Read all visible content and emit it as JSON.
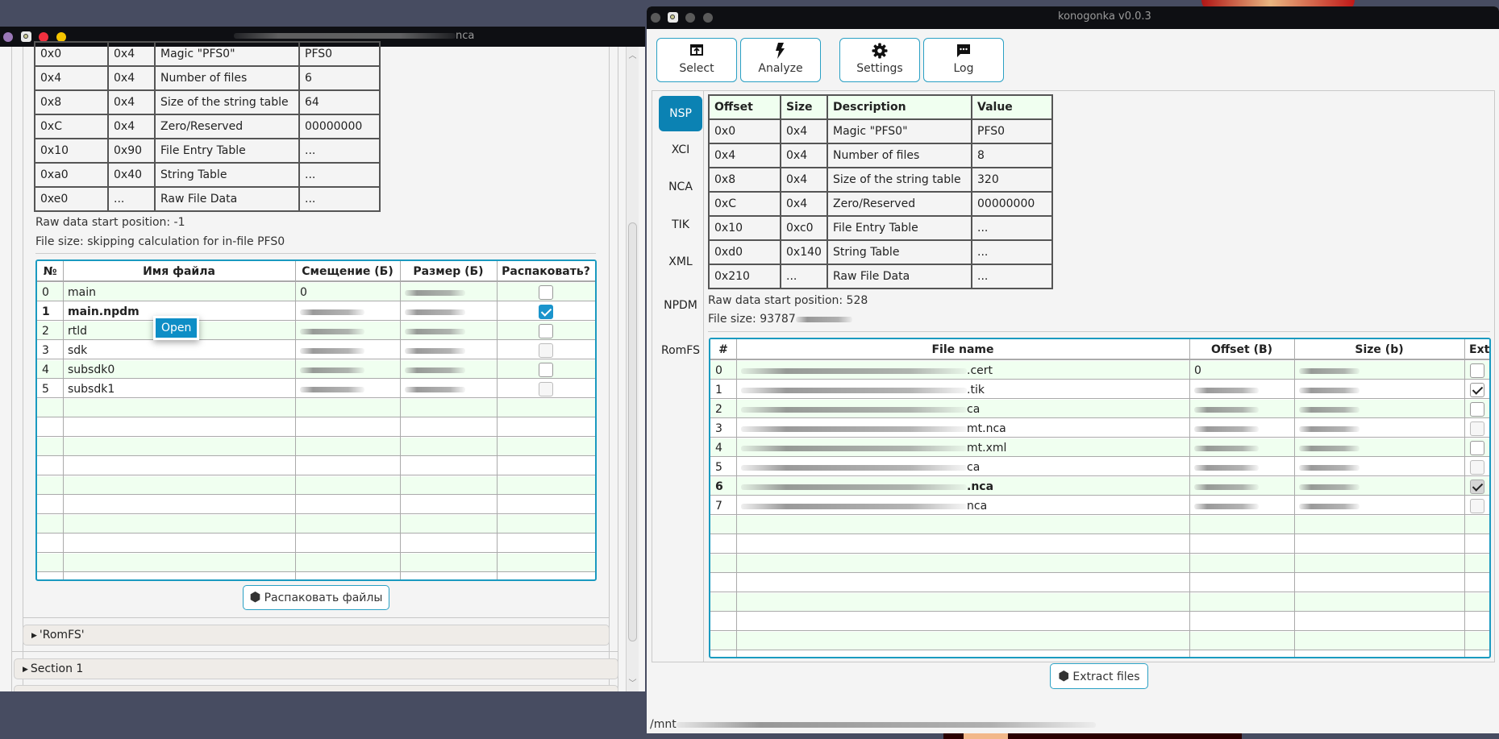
{
  "left_window": {
    "title_suffix": "nca",
    "header_table": {
      "rows": [
        [
          "0x0",
          "0x4",
          "Magic \"PFS0\"",
          "PFS0"
        ],
        [
          "0x4",
          "0x4",
          "Number of files",
          "6"
        ],
        [
          "0x8",
          "0x4",
          "Size of the string table",
          "64"
        ],
        [
          "0xC",
          "0x4",
          "Zero/Reserved",
          "00000000"
        ],
        [
          "0x10",
          "0x90",
          "File Entry Table",
          "..."
        ],
        [
          "0xa0",
          "0x40",
          "String Table",
          "..."
        ],
        [
          "0xe0",
          "...",
          "Raw File Data",
          "..."
        ]
      ]
    },
    "raw_data_start": "Raw data start position: -1",
    "file_size": "File size: skipping calculation for in-file PFS0",
    "file_table": {
      "columns": [
        "№",
        "Имя файла",
        "Смещение (Б)",
        "Размер (Б)",
        "Распаковать?"
      ],
      "rows": [
        {
          "num": "0",
          "name": "main",
          "offset": "0",
          "extract": false,
          "bold": false
        },
        {
          "num": "1",
          "name": "main.npdm",
          "offset": "",
          "extract": true,
          "bold": true
        },
        {
          "num": "2",
          "name": "rtld",
          "offset": "",
          "extract": false,
          "bold": false
        },
        {
          "num": "3",
          "name": "sdk",
          "offset": "",
          "extract": false,
          "bold": false
        },
        {
          "num": "4",
          "name": "subsdk0",
          "offset": "",
          "extract": false,
          "bold": false
        },
        {
          "num": "5",
          "name": "subsdk1",
          "offset": "",
          "extract": false,
          "bold": false
        }
      ],
      "empty_rows": 9
    },
    "context_menu": {
      "items": [
        "Open"
      ]
    },
    "extract_button": "Распаковать файлы",
    "romfs_section": "'RomFS'",
    "section1": "Section 1"
  },
  "right_window": {
    "title": "konogonka v0.0.3",
    "toolbar": {
      "select": "Select",
      "analyze": "Analyze",
      "settings": "Settings",
      "log": "Log"
    },
    "side_tabs": [
      {
        "label": "NSP",
        "active": true
      },
      {
        "label": "XCI",
        "active": false
      },
      {
        "label": "NCA",
        "active": false
      },
      {
        "label": "TIK",
        "active": false
      },
      {
        "label": "XML",
        "active": false
      },
      {
        "label": "NPDM",
        "active": false
      },
      {
        "label": "RomFS",
        "active": false
      }
    ],
    "header_table": {
      "columns": [
        "Offset",
        "Size",
        "Description",
        "Value"
      ],
      "rows": [
        [
          "0x0",
          "0x4",
          "Magic \"PFS0\"",
          "PFS0"
        ],
        [
          "0x4",
          "0x4",
          "Number of files",
          "8"
        ],
        [
          "0x8",
          "0x4",
          "Size of the string table",
          "320"
        ],
        [
          "0xC",
          "0x4",
          "Zero/Reserved",
          "00000000"
        ],
        [
          "0x10",
          "0xc0",
          "File Entry Table",
          "..."
        ],
        [
          "0xd0",
          "0x140",
          "String Table",
          "..."
        ],
        [
          "0x210",
          "...",
          "Raw File Data",
          "..."
        ]
      ]
    },
    "raw_data_start": "Raw data start position: 528",
    "file_size_prefix": "File size: 93787",
    "file_table": {
      "columns": [
        "#",
        "File name",
        "Offset (B)",
        "Size (b)",
        "Extract?"
      ],
      "rows": [
        {
          "num": "0",
          "name_suffix": ".cert",
          "offset": "0",
          "extract": "off",
          "bold": false
        },
        {
          "num": "1",
          "name_suffix": ".tik",
          "offset": "",
          "extract": "tick",
          "bold": false
        },
        {
          "num": "2",
          "name_suffix": "ca",
          "offset": "",
          "extract": "off",
          "bold": false
        },
        {
          "num": "3",
          "name_suffix": "mt.nca",
          "offset": "",
          "extract": "dim",
          "bold": false
        },
        {
          "num": "4",
          "name_suffix": "mt.xml",
          "offset": "",
          "extract": "off",
          "bold": false
        },
        {
          "num": "5",
          "name_suffix": "ca",
          "offset": "",
          "extract": "dim",
          "bold": false
        },
        {
          "num": "6",
          "name_suffix": ".nca",
          "offset": "",
          "extract": "tick-gray",
          "bold": true
        },
        {
          "num": "7",
          "name_suffix": "nca",
          "offset": "",
          "extract": "dim",
          "bold": false
        }
      ],
      "empty_rows": 7
    },
    "extract_button": "Extract files",
    "status_path_prefix": "/mnt"
  }
}
